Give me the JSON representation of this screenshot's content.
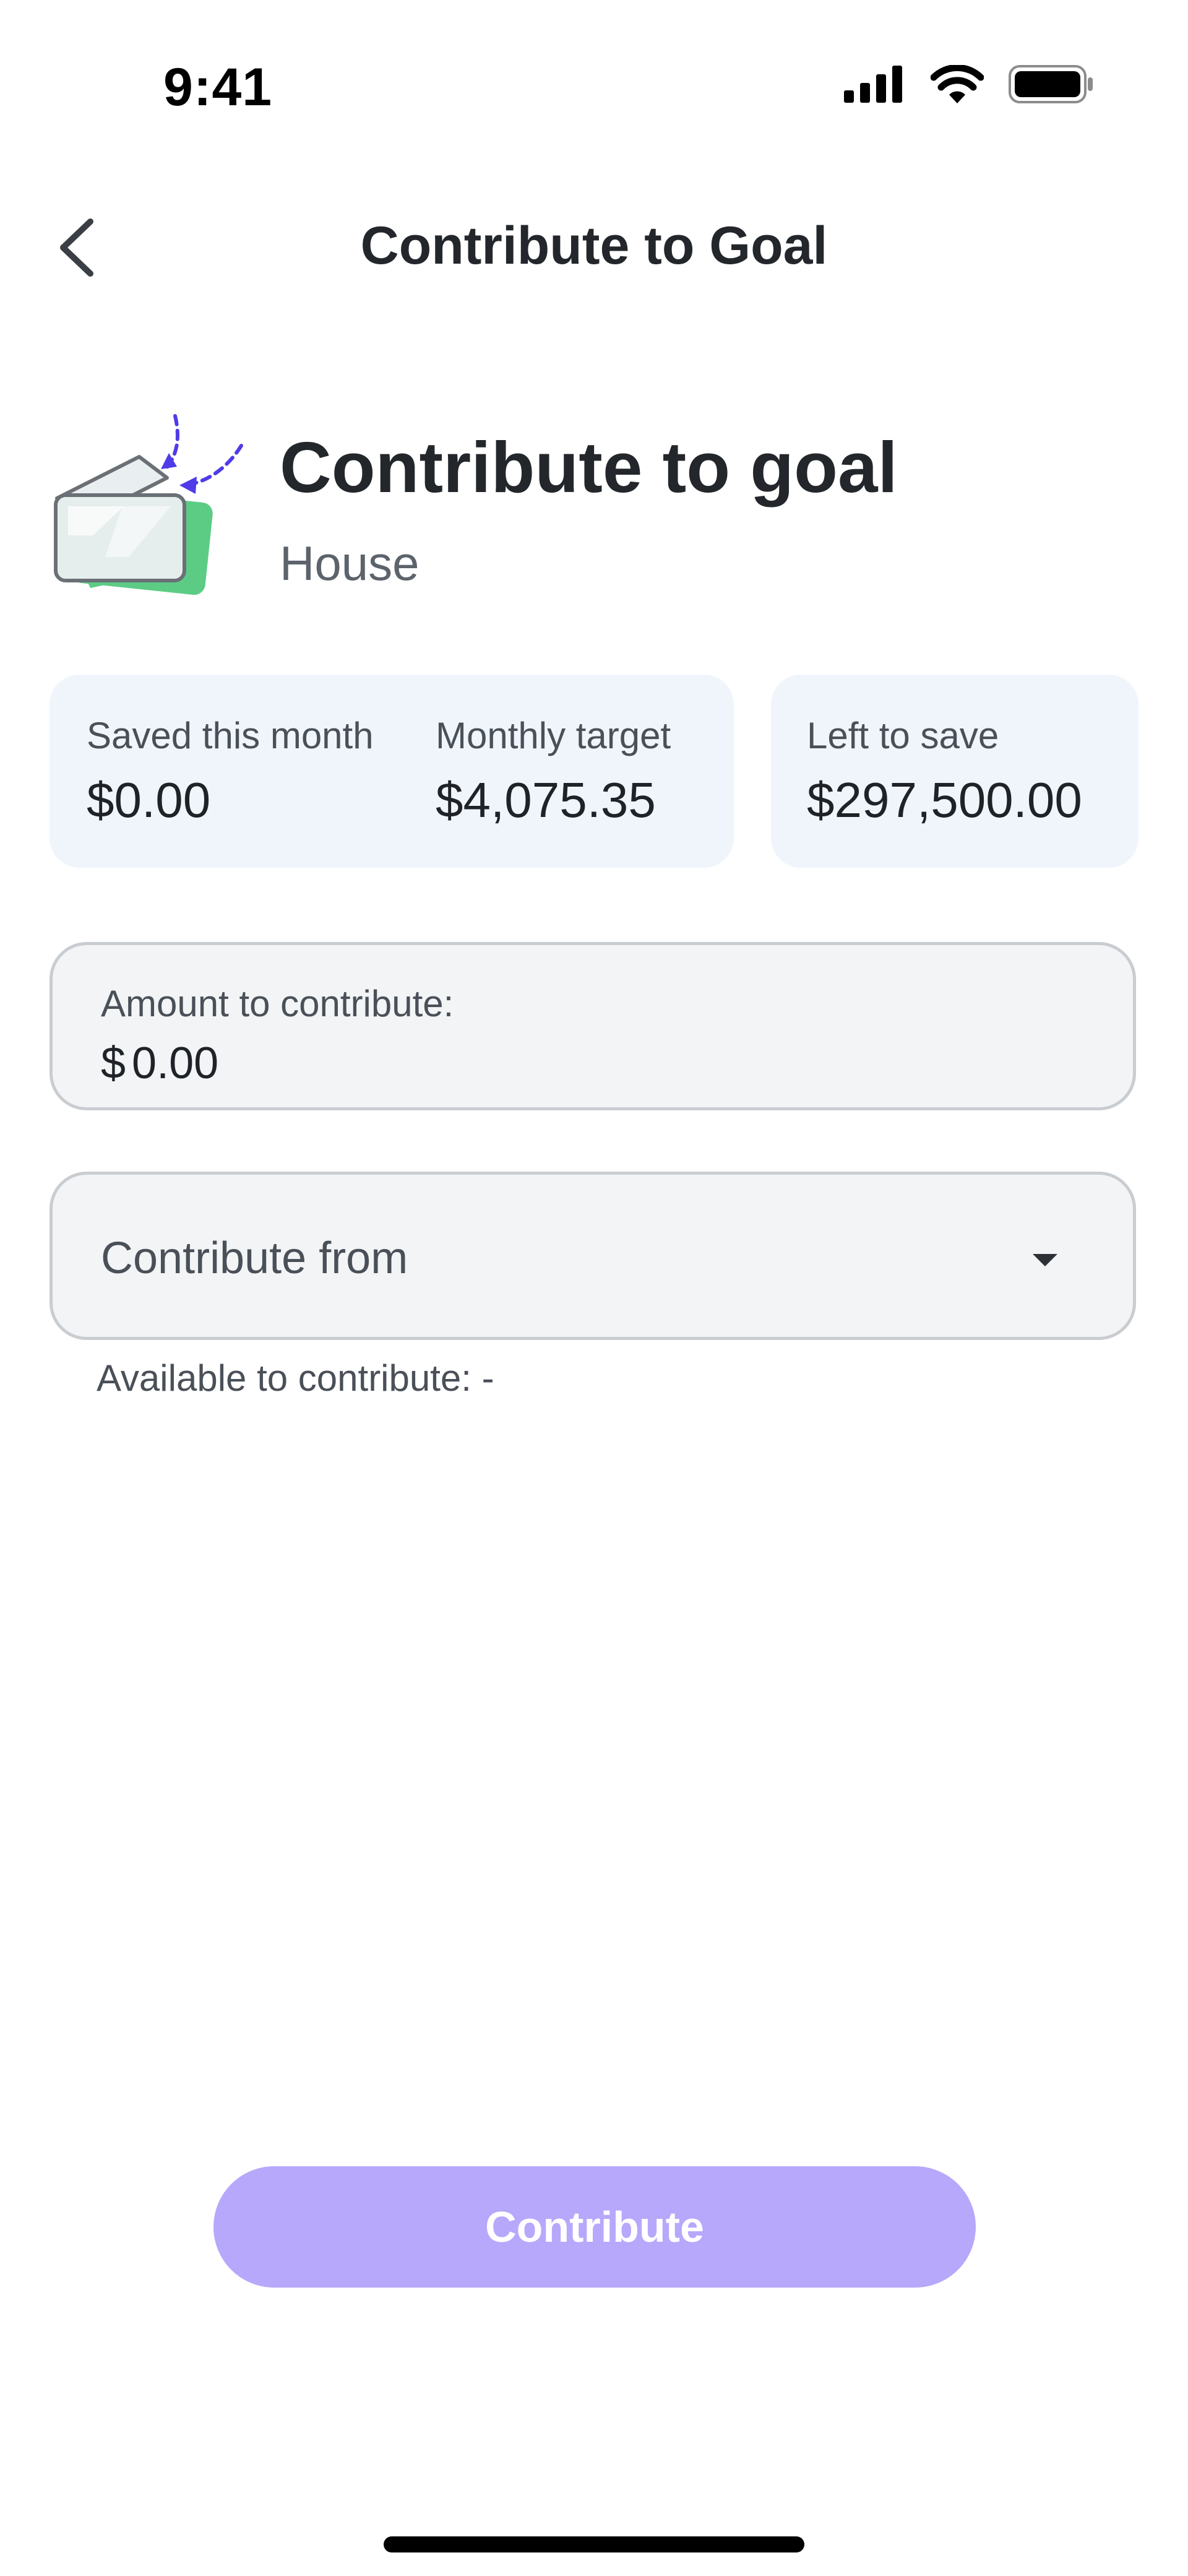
{
  "status_bar": {
    "time": "9:41"
  },
  "nav": {
    "title": "Contribute to Goal"
  },
  "hero": {
    "title": "Contribute to goal",
    "goal_name": "House"
  },
  "stats": {
    "saved_label": "Saved this month",
    "saved_value": "$0.00",
    "target_label": "Monthly target",
    "target_value": "$4,075.35",
    "left_label": "Left to save",
    "left_value": "$297,500.00"
  },
  "amount_field": {
    "label": "Amount to contribute:",
    "currency": "$",
    "value": "0.00"
  },
  "source_field": {
    "placeholder": "Contribute from"
  },
  "available": "Available to contribute: -",
  "cta": {
    "label": "Contribute"
  },
  "colors": {
    "accent": "#4f3be8",
    "button_disabled": "#b7a8fb",
    "card_bg": "#f0f5fc",
    "card_green": "#5ccc85"
  }
}
